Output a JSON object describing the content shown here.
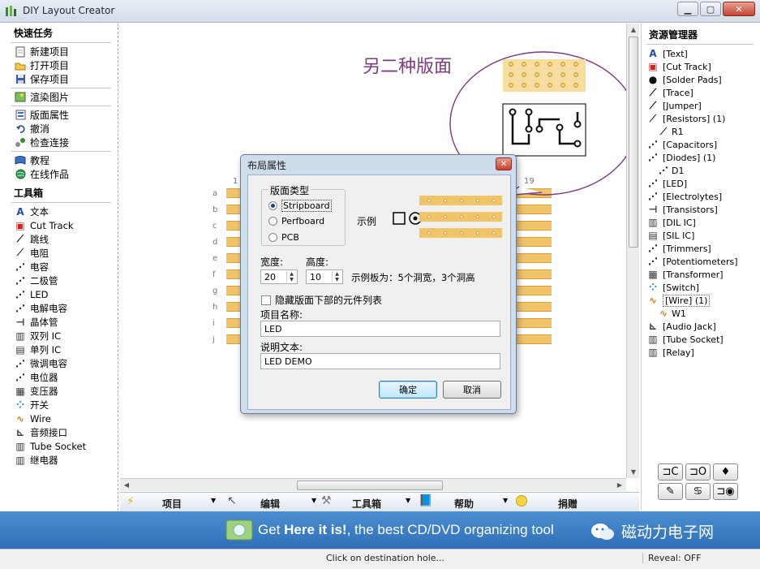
{
  "window": {
    "title": "DIY Layout Creator",
    "controls": [
      "minimize",
      "maximize",
      "close"
    ]
  },
  "left_panel": {
    "quick_tasks_header": "快速任务",
    "quick_tasks": [
      {
        "label": "新建项目",
        "icon": "new-file-icon"
      },
      {
        "label": "打开项目",
        "icon": "open-folder-icon"
      },
      {
        "label": "保存项目",
        "icon": "save-disk-icon"
      },
      {
        "label": "渲染图片",
        "icon": "image-icon"
      },
      {
        "label": "版面属性",
        "icon": "properties-icon"
      },
      {
        "label": "撤消",
        "icon": "undo-icon"
      },
      {
        "label": "检查连接",
        "icon": "check-connections-icon"
      },
      {
        "label": "教程",
        "icon": "tutorial-icon"
      },
      {
        "label": "在线作品",
        "icon": "globe-icon"
      }
    ],
    "toolbox_header": "工具箱",
    "tools": [
      {
        "label": "文本",
        "icon": "text-icon"
      },
      {
        "label": "Cut Track",
        "icon": "cut-track-icon"
      },
      {
        "label": "跳线",
        "icon": "jumper-icon"
      },
      {
        "label": "电阻",
        "icon": "resistor-icon"
      },
      {
        "label": "电容",
        "icon": "capacitor-icon"
      },
      {
        "label": "二极管",
        "icon": "diode-icon"
      },
      {
        "label": "LED",
        "icon": "led-icon"
      },
      {
        "label": "电解电容",
        "icon": "electrolytic-icon"
      },
      {
        "label": "晶体管",
        "icon": "transistor-icon"
      },
      {
        "label": "双列 IC",
        "icon": "dil-ic-icon"
      },
      {
        "label": "单列 IC",
        "icon": "sil-ic-icon"
      },
      {
        "label": "微调电容",
        "icon": "trimmer-icon"
      },
      {
        "label": "电位器",
        "icon": "potentiometer-icon"
      },
      {
        "label": "变压器",
        "icon": "transformer-icon"
      },
      {
        "label": "开关",
        "icon": "switch-icon"
      },
      {
        "label": "Wire",
        "icon": "wire-icon"
      },
      {
        "label": "音频接口",
        "icon": "audio-jack-icon"
      },
      {
        "label": "Tube Socket",
        "icon": "tube-socket-icon"
      },
      {
        "label": "继电器",
        "icon": "relay-icon"
      }
    ]
  },
  "canvas": {
    "annotation_title": "另二种版面",
    "column_numbers": [
      "1",
      "19"
    ],
    "row_labels": [
      "a",
      "b",
      "c",
      "d",
      "e",
      "f",
      "g",
      "h",
      "i",
      "j"
    ]
  },
  "dialog": {
    "title": "布局属性",
    "board_type_label": "版面类型",
    "board_types": [
      {
        "label": "Stripboard",
        "selected": true
      },
      {
        "label": "Perfboard",
        "selected": false
      },
      {
        "label": "PCB",
        "selected": false
      }
    ],
    "example_label": "示例",
    "width_label": "宽度:",
    "width_value": "20",
    "height_label": "高度:",
    "height_value": "10",
    "example_board_text": "示例板为：5个洞宽，3个洞高",
    "hide_parts_label": "隐藏版面下部的元件列表",
    "hide_parts_checked": false,
    "project_name_label": "项目名称:",
    "project_name_value": "LED",
    "description_label": "说明文本:",
    "description_value": "LED DEMO",
    "ok_label": "确定",
    "cancel_label": "取消"
  },
  "bottom_toolbar": {
    "items": [
      "项目",
      "编辑",
      "工具箱",
      "帮助",
      "捐赠"
    ]
  },
  "right_panel": {
    "header": "资源管理器",
    "items": [
      {
        "label": "[Text]",
        "level": 0,
        "icon": "text-icon"
      },
      {
        "label": "[Cut Track]",
        "level": 0,
        "icon": "cut-track-icon"
      },
      {
        "label": "[Solder Pads]",
        "level": 0,
        "icon": "solder-pad-icon"
      },
      {
        "label": "[Trace]",
        "level": 0,
        "icon": "trace-icon"
      },
      {
        "label": "[Jumper]",
        "level": 0,
        "icon": "jumper-icon"
      },
      {
        "label": "[Resistors] (1)",
        "level": 0,
        "icon": "resistor-icon"
      },
      {
        "label": "R1",
        "level": 1,
        "icon": "resistor-icon"
      },
      {
        "label": "[Capacitors]",
        "level": 0,
        "icon": "capacitor-icon"
      },
      {
        "label": "[Diodes] (1)",
        "level": 0,
        "icon": "diode-icon"
      },
      {
        "label": "D1",
        "level": 1,
        "icon": "diode-icon"
      },
      {
        "label": "[LED]",
        "level": 0,
        "icon": "led-icon"
      },
      {
        "label": "[Electrolytes]",
        "level": 0,
        "icon": "electrolytic-icon"
      },
      {
        "label": "[Transistors]",
        "level": 0,
        "icon": "transistor-icon"
      },
      {
        "label": "[DIL IC]",
        "level": 0,
        "icon": "dil-ic-icon"
      },
      {
        "label": "[SIL IC]",
        "level": 0,
        "icon": "sil-ic-icon"
      },
      {
        "label": "[Trimmers]",
        "level": 0,
        "icon": "trimmer-icon"
      },
      {
        "label": "[Potentiometers]",
        "level": 0,
        "icon": "potentiometer-icon"
      },
      {
        "label": "[Transformer]",
        "level": 0,
        "icon": "transformer-icon"
      },
      {
        "label": "[Switch]",
        "level": 0,
        "icon": "switch-icon"
      },
      {
        "label": "[Wire] (1)",
        "level": 0,
        "icon": "wire-icon",
        "selected": true
      },
      {
        "label": "W1",
        "level": 1,
        "icon": "wire-icon"
      },
      {
        "label": "[Audio Jack]",
        "level": 0,
        "icon": "audio-jack-icon"
      },
      {
        "label": "[Tube Socket]",
        "level": 0,
        "icon": "tube-socket-icon"
      },
      {
        "label": "[Relay]",
        "level": 0,
        "icon": "relay-icon"
      }
    ],
    "buttons": [
      {
        "label": "⊐C",
        "name": "align-left-button"
      },
      {
        "label": "⊐O",
        "name": "align-pad-button"
      },
      {
        "label": "♦",
        "name": "diamond-button"
      },
      {
        "label": "✎",
        "name": "edit-button"
      },
      {
        "label": "♋",
        "name": "flip-button"
      },
      {
        "label": "⊐◉",
        "name": "pad-target-button"
      }
    ]
  },
  "banner": {
    "text_prefix": "Get ",
    "text_bold": "Here it is!",
    "text_suffix": ", the best CD/DVD organizing tool",
    "wechat_text": "磁动力电子网"
  },
  "statusbar": {
    "message": "Click on destination hole...",
    "reveal": "Reveal: OFF"
  },
  "colors": {
    "stripboard_copper": "#f2c46a",
    "annotation_purple": "#7a3d7d",
    "banner_blue": "#3a7fc4"
  }
}
